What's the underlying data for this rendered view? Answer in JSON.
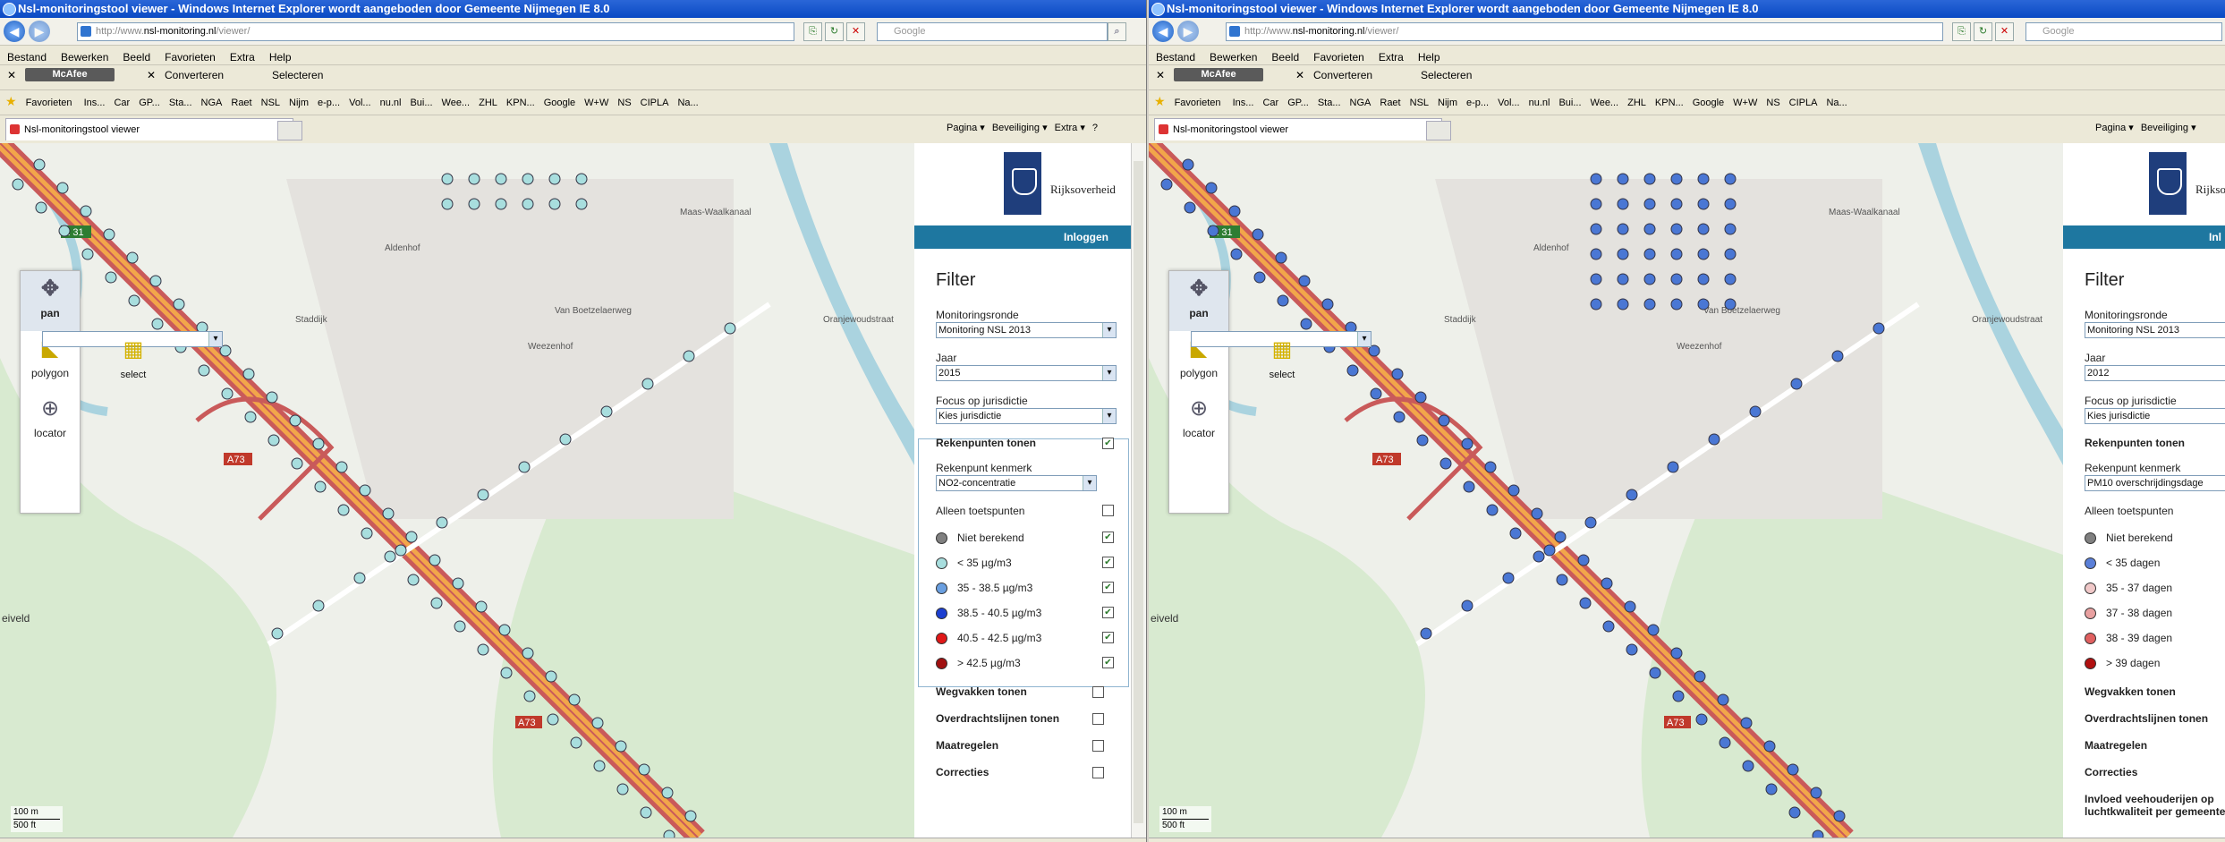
{
  "left": {
    "title": "Nsl-monitoringstool viewer - Windows Internet Explorer wordt aangeboden door Gemeente Nijmegen IE 8.0",
    "address_dim": "http://www.",
    "address_host": "nsl-monitoring.nl",
    "address_path": "/viewer/",
    "search_placeholder": "Google",
    "menu": [
      "Bestand",
      "Bewerken",
      "Beeld",
      "Favorieten",
      "Extra",
      "Help"
    ],
    "mcafee": {
      "logo": "McAfee",
      "convert": "Converteren",
      "select": "Selecteren"
    },
    "favorites": {
      "label": "Favorieten",
      "items": [
        "Ins...",
        "Car",
        "GP...",
        "Sta...",
        "NGA",
        "Raet",
        "NSL",
        "Nijm",
        "e-p...",
        "Vol...",
        "nu.nl",
        "Bui...",
        "Wee...",
        "ZHL",
        "KPN...",
        "Google",
        "W+W",
        "NS",
        "CIPLA",
        "Na..."
      ]
    },
    "tab": "Nsl-monitoringstool viewer",
    "commands": [
      "Pagina ▾",
      "Beveiliging ▾",
      "Extra ▾",
      "?"
    ],
    "tools": [
      {
        "label": "pan",
        "icon": "✥"
      },
      {
        "label": "select",
        "icon": "▦"
      },
      {
        "label": "polygon",
        "icon": "◣"
      },
      {
        "label": "locator",
        "icon": "⊕"
      }
    ],
    "scale": {
      "m": "100 m",
      "ft": "500 ft"
    },
    "map_labels": {
      "e31": "E 31",
      "a73a": "A73",
      "a73b": "A73",
      "eiveld": "eiveld",
      "road1": "Van Boetzelaerweg",
      "road2": "Maas-Waalkanaal",
      "road3": "Weezenhof",
      "road4": "Aldenhof",
      "road5": "Staddijk",
      "road6": "Oranjewoudstraat"
    },
    "panel": {
      "logo": "Rijksoverheid",
      "login": "Inloggen",
      "filter": "Filter",
      "monitoringsronde_label": "Monitoringsronde",
      "monitoringsronde_value": "Monitoring NSL 2013",
      "jaar_label": "Jaar",
      "jaar_value": "2015",
      "focus_label": "Focus op jurisdictie",
      "focus_value": "Kies jurisdictie",
      "rekenpunten": "Rekenpunten tonen",
      "kenmerk_label": "Rekenpunt kenmerk",
      "kenmerk_value": "NO2-concentratie",
      "toetspunten": "Alleen toetspunten",
      "legend": [
        {
          "label": "Niet berekend",
          "color": "#808080"
        },
        {
          "label": "< 35 µg/m3",
          "color": "#a8dede"
        },
        {
          "label": "35 - 38.5 µg/m3",
          "color": "#6a9fe0"
        },
        {
          "label": "38.5 - 40.5 µg/m3",
          "color": "#1c3fd0"
        },
        {
          "label": "40.5 - 42.5 µg/m3",
          "color": "#e01818"
        },
        {
          "label": "> 42.5 µg/m3",
          "color": "#a01010"
        }
      ],
      "sections": [
        "Wegvakken tonen",
        "Overdrachtslijnen tonen",
        "Maatregelen",
        "Correcties"
      ]
    }
  },
  "right": {
    "title": "Nsl-monitoringstool viewer - Windows Internet Explorer wordt aangeboden door Gemeente Nijmegen IE 8.0",
    "address_dim": "http://www.",
    "address_host": "nsl-monitoring.nl",
    "address_path": "/viewer/",
    "search_placeholder": "Google",
    "menu": [
      "Bestand",
      "Bewerken",
      "Beeld",
      "Favorieten",
      "Extra",
      "Help"
    ],
    "mcafee": {
      "logo": "McAfee",
      "convert": "Converteren",
      "select": "Selecteren"
    },
    "favorites": {
      "label": "Favorieten",
      "items": [
        "Ins...",
        "Car",
        "GP...",
        "Sta...",
        "NGA",
        "Raet",
        "NSL",
        "Nijm",
        "e-p...",
        "Vol...",
        "nu.nl",
        "Bui...",
        "Wee...",
        "ZHL",
        "KPN...",
        "Google",
        "W+W",
        "NS",
        "CIPLA",
        "Na..."
      ]
    },
    "tab": "Nsl-monitoringstool viewer",
    "commands": [
      "Pagina ▾",
      "Beveiliging ▾"
    ],
    "tools": [
      {
        "label": "pan",
        "icon": "✥"
      },
      {
        "label": "select",
        "icon": "▦"
      },
      {
        "label": "polygon",
        "icon": "◣"
      },
      {
        "label": "locator",
        "icon": "⊕"
      }
    ],
    "scale": {
      "m": "100 m",
      "ft": "500 ft"
    },
    "map_labels": {
      "e31": "E 31",
      "a73a": "A73",
      "a73b": "A73",
      "eiveld": "eiveld",
      "road1": "Van Boetzelaerweg",
      "road2": "Maas-Waalkanaal",
      "road3": "Weezenhof",
      "road4": "Aldenhof",
      "road5": "Staddijk",
      "road6": "Oranjewoudstraat"
    },
    "panel": {
      "logo": "Rijksoverheid",
      "login": "Inl",
      "filter": "Filter",
      "monitoringsronde_label": "Monitoringsronde",
      "monitoringsronde_value": "Monitoring NSL 2013",
      "jaar_label": "Jaar",
      "jaar_value": "2012",
      "focus_label": "Focus op jurisdictie",
      "focus_value": "Kies jurisdictie",
      "rekenpunten": "Rekenpunten tonen",
      "kenmerk_label": "Rekenpunt kenmerk",
      "kenmerk_value": "PM10 overschrijdingsdage",
      "toetspunten": "Alleen toetspunten",
      "legend": [
        {
          "label": "Niet berekend",
          "color": "#808080"
        },
        {
          "label": "< 35 dagen",
          "color": "#5a7fd8"
        },
        {
          "label": "35 - 37 dagen",
          "color": "#f0c8c8"
        },
        {
          "label": "37 - 38 dagen",
          "color": "#e8a0a0"
        },
        {
          "label": "38 - 39 dagen",
          "color": "#e06060"
        },
        {
          "label": "> 39 dagen",
          "color": "#b01010"
        }
      ],
      "sections": [
        "Wegvakken tonen",
        "Overdrachtslijnen tonen",
        "Maatregelen",
        "Correcties",
        "Invloed veehouderijen op luchtkwaliteit per gemeente"
      ]
    }
  }
}
